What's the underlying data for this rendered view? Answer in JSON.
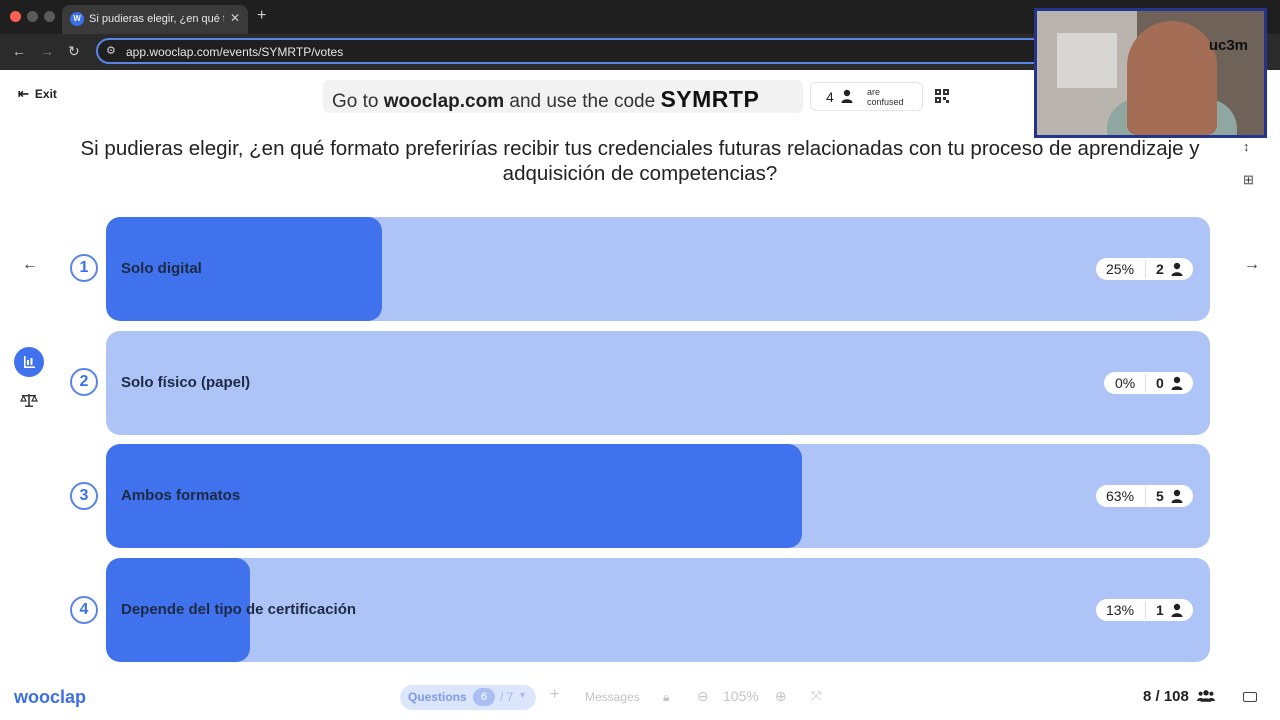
{
  "browser": {
    "tab_title": "Si pudieras elegir, ¿en qué fo",
    "url": "app.wooclap.com/events/SYMRTP/votes",
    "favicon_letter": "W"
  },
  "header": {
    "exit_label": "Exit",
    "banner_prefix": "Go to ",
    "banner_site": "wooclap.com",
    "banner_middle": " and use the code ",
    "banner_code": "SYMRTP",
    "confused_count": "4",
    "confused_line1": "are",
    "confused_line2": "confused"
  },
  "webcam": {
    "logo_text": "uc3m"
  },
  "question": {
    "text": "Si pudieras elegir, ¿en qué formato preferirías recibir tus credenciales futuras relacionadas con tu proceso de aprendizaje y adquisición de competencias?"
  },
  "answers": [
    {
      "number": "1",
      "label": "Solo digital",
      "percent_text": "25%",
      "count": "2",
      "fill_fraction": 0.25
    },
    {
      "number": "2",
      "label": "Solo físico (papel)",
      "percent_text": "0%",
      "count": "0",
      "fill_fraction": 0.0
    },
    {
      "number": "3",
      "label": "Ambos formatos",
      "percent_text": "63%",
      "count": "5",
      "fill_fraction": 0.63
    },
    {
      "number": "4",
      "label": "Depende del tipo de certificación",
      "percent_text": "13%",
      "count": "1",
      "fill_fraction": 0.13
    }
  ],
  "footer": {
    "logo": "wooclap",
    "questions_label": "Questions",
    "questions_current": "6",
    "questions_total": "/ 7",
    "messages_label": "Messages",
    "zoom_label": "105%",
    "participants": "8 / 108"
  },
  "colors": {
    "accent": "#3f72ec",
    "bar_background": "#aec4f7"
  },
  "icons": [
    "exit-icon",
    "user-icon",
    "qr-icon",
    "arrow-left-icon",
    "arrow-right-icon",
    "chart-icon",
    "balance-icon",
    "expand-icon",
    "grid-icon",
    "plus-icon",
    "lock-icon",
    "zoom-out-icon",
    "zoom-in-icon",
    "fullscreen-icon",
    "participants-icon",
    "keyboard-icon"
  ]
}
